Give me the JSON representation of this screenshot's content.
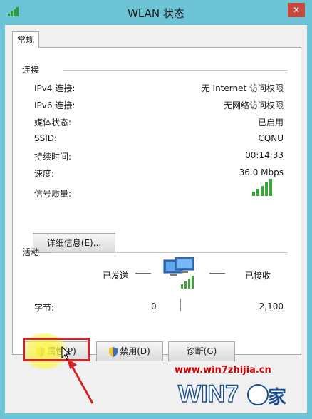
{
  "window": {
    "title": "WLAN 状态",
    "close_label": "✕",
    "accent": "#6cc4d6"
  },
  "tabs": [
    {
      "label": "常规"
    }
  ],
  "connection": {
    "section_title": "连接",
    "rows": [
      {
        "label": "IPv4 连接:",
        "value": "无 Internet 访问权限"
      },
      {
        "label": "IPv6 连接:",
        "value": "无网络访问权限"
      },
      {
        "label": "媒体状态:",
        "value": "已启用"
      },
      {
        "label": "SSID:",
        "value": "CQNU"
      },
      {
        "label": "持续时间:",
        "value": "00:14:33"
      },
      {
        "label": "速度:",
        "value": "36.0 Mbps"
      }
    ],
    "signal_label": "信号质量:",
    "signal_bars": 5,
    "details_button": "详细信息(E)..."
  },
  "activity": {
    "section_title": "活动",
    "sent_label": "已发送",
    "received_label": "已接收",
    "bytes_label": "字节:",
    "bytes_sent": "0",
    "bytes_received": "2,100"
  },
  "buttons": {
    "properties": "属性(P)",
    "disable": "禁用(D)",
    "diagnose": "诊断(G)"
  },
  "watermark": {
    "url": "www.win7zhijia.cn",
    "logo_text": "WIN7",
    "logo_suffix": "家"
  }
}
